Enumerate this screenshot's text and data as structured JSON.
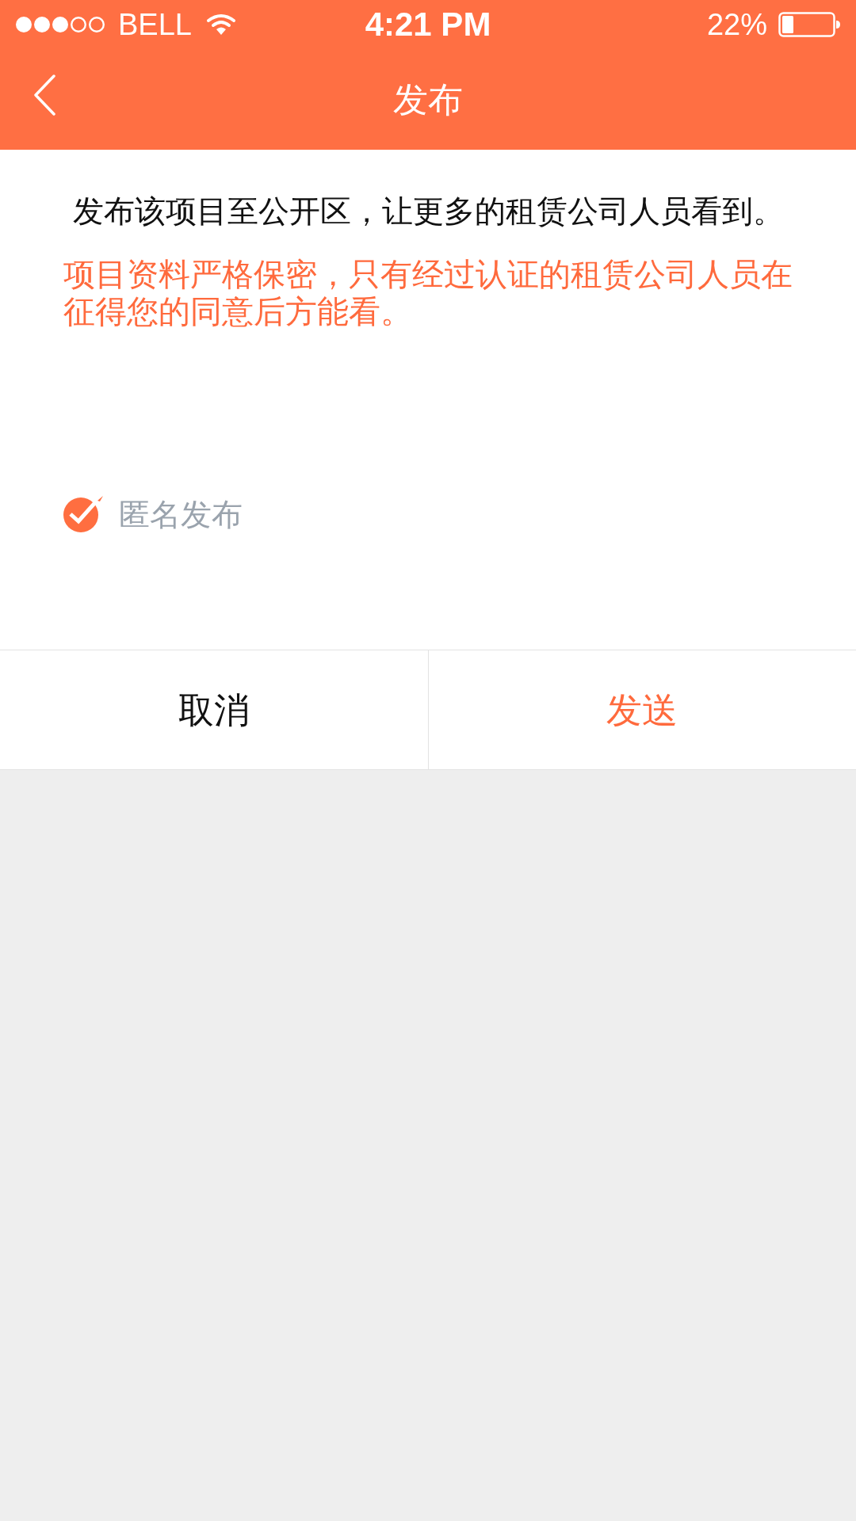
{
  "status_bar": {
    "carrier": "BELL",
    "time": "4:21 PM",
    "battery": "22%"
  },
  "nav_bar": {
    "title": "发布"
  },
  "message": {
    "text": "发布该项目至公开区，让更多的租赁公司人员看到。",
    "notice": "项目资料严格保密，只有经过认证的租赁公司人员在征得您的同意后方能看。"
  },
  "anonymous_option": {
    "label": "匿名发布",
    "checked": true
  },
  "buttons": [
    {
      "label": "取消",
      "kind": "cancel"
    },
    {
      "label": "发送",
      "kind": "confirm"
    }
  ]
}
